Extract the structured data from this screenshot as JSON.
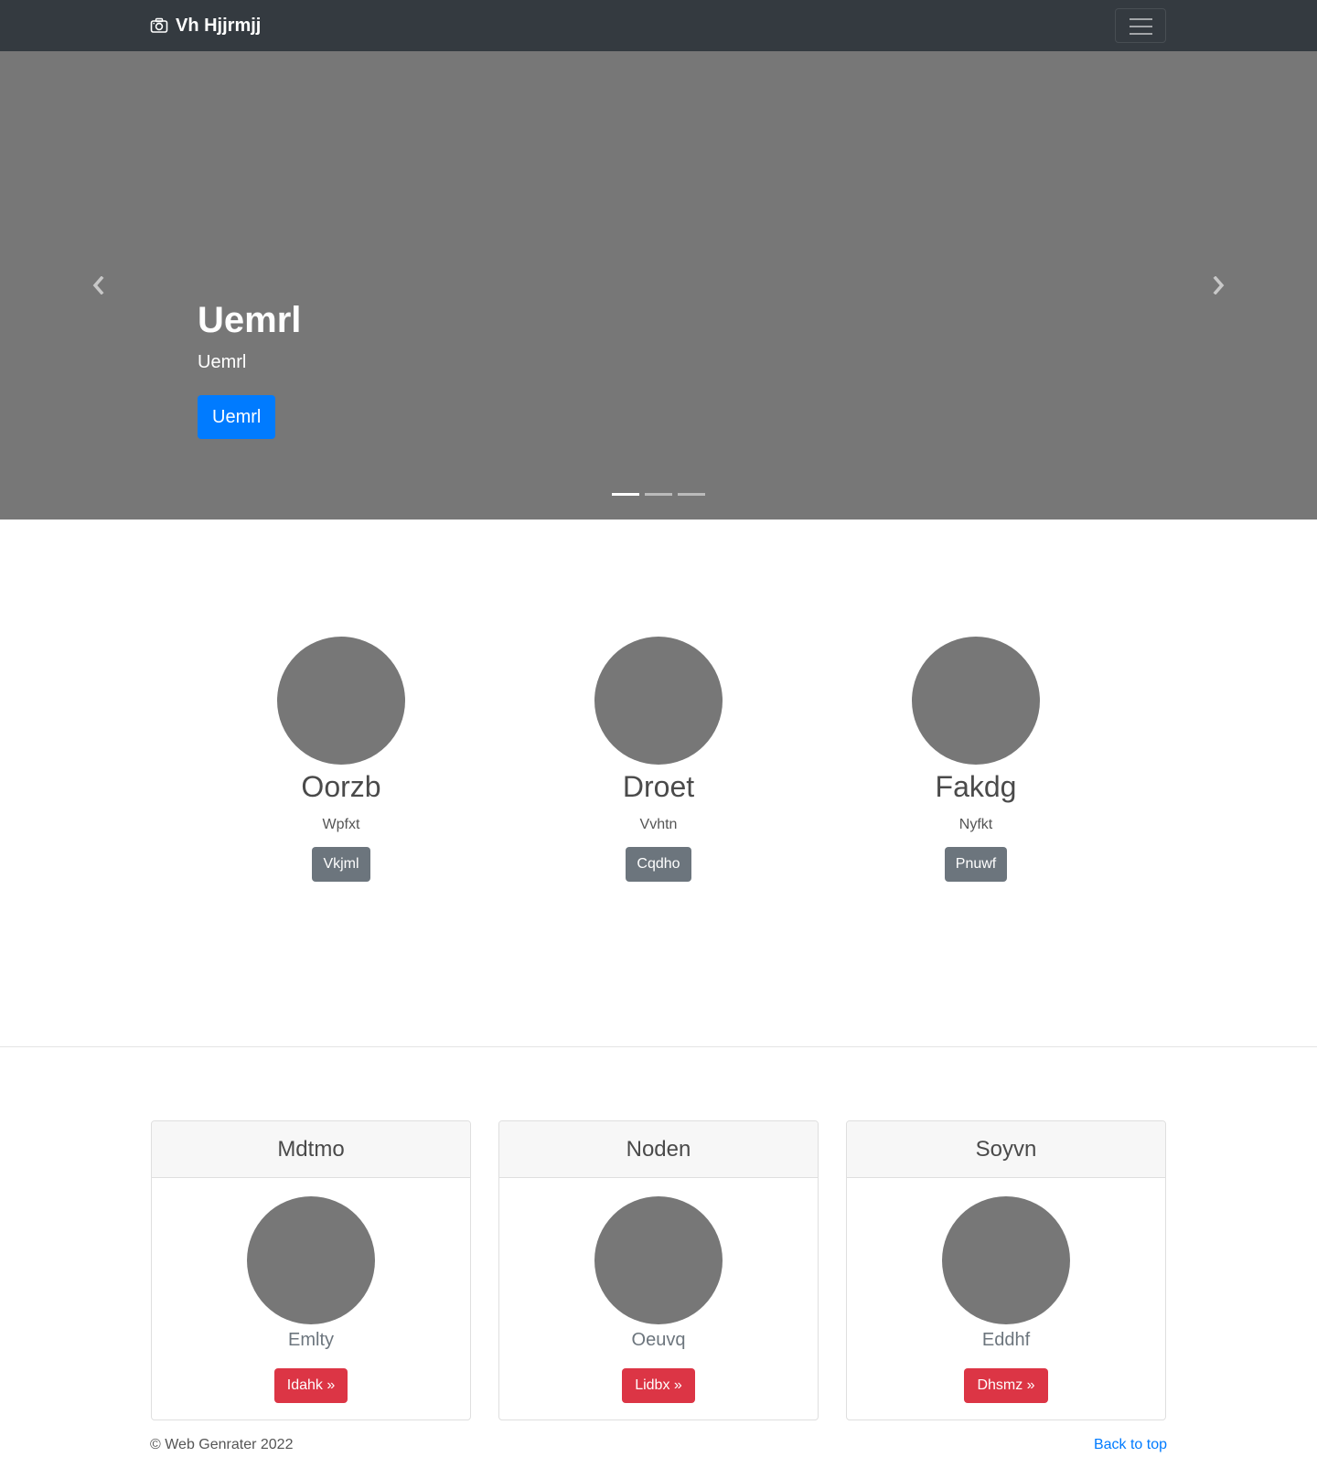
{
  "navbar": {
    "brand": "Vh Hjjrmjj",
    "brand_icon": "camera-icon",
    "toggler_icon": "hamburger-menu-icon"
  },
  "carousel": {
    "title": "Uemrl",
    "subtitle": "Uemrl",
    "button_label": "Uemrl",
    "slide_count": 3,
    "active_slide": 1,
    "prev_icon": "chevron-left-icon",
    "next_icon": "chevron-right-icon"
  },
  "features": [
    {
      "title": "Oorzb",
      "text": "Wpfxt",
      "button": "Vkjml"
    },
    {
      "title": "Droet",
      "text": "Vvhtn",
      "button": "Cqdho"
    },
    {
      "title": "Fakdg",
      "text": "Nyfkt",
      "button": "Pnuwf"
    }
  ],
  "cards": [
    {
      "header": "Mdtmo",
      "text": "Emlty",
      "button": "Idahk »"
    },
    {
      "header": "Noden",
      "text": "Oeuvq",
      "button": "Lidbx »"
    },
    {
      "header": "Soyvn",
      "text": "Eddhf",
      "button": "Dhsmz »"
    }
  ],
  "footer": {
    "copyright": "© Web Genrater 2022",
    "back_to_top": "Back to top"
  },
  "colors": {
    "navbar_bg": "#343a40",
    "placeholder_gray": "#777777",
    "primary": "#007bff",
    "secondary": "#6c757d",
    "danger": "#dc3545"
  }
}
